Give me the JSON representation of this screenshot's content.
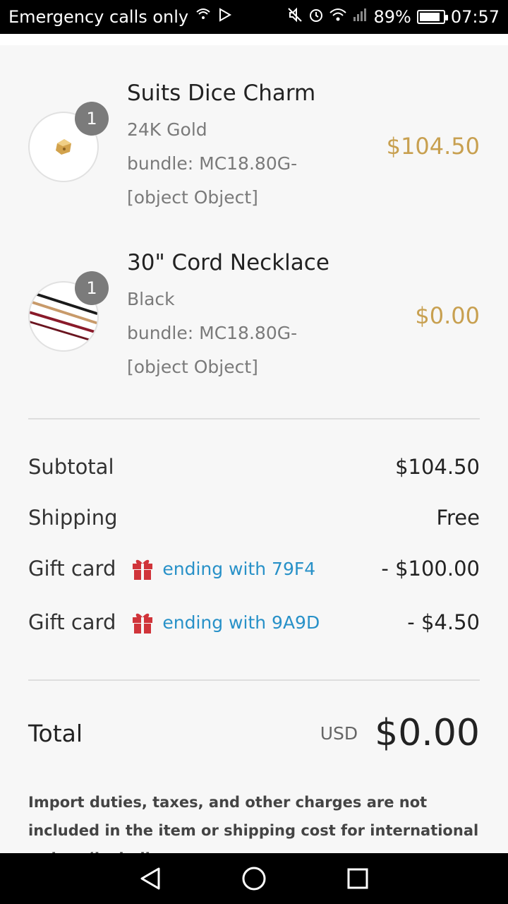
{
  "status_bar": {
    "carrier": "Emergency calls only",
    "battery": "89%",
    "battery_level": 0.89,
    "time": "07:57"
  },
  "items": [
    {
      "title": "Suits Dice Charm",
      "variant": "24K Gold",
      "bundle": "bundle: MC18.80G-[object Object]",
      "price": "$104.50",
      "quantity": "1",
      "thumb": "gold-dice-charm"
    },
    {
      "title": "30\" Cord Necklace",
      "variant": "Black",
      "bundle": "bundle: MC18.80G-[object Object]",
      "price": "$0.00",
      "quantity": "1",
      "thumb": "cord-necklace"
    }
  ],
  "summary": {
    "subtotal_label": "Subtotal",
    "subtotal_value": "$104.50",
    "shipping_label": "Shipping",
    "shipping_value": "Free",
    "gift_cards": [
      {
        "label": "Gift card",
        "ending": "ending with 79F4",
        "amount": "- $100.00"
      },
      {
        "label": "Gift card",
        "ending": "ending with 9A9D",
        "amount": "- $4.50"
      }
    ],
    "total_label": "Total",
    "currency": "USD",
    "total_value": "$0.00"
  },
  "notice": "Import duties, taxes, and other charges are not included in the item or shipping cost for international orders (including",
  "colors": {
    "price_gold": "#c8a050",
    "gift_red": "#d0343a",
    "link_blue": "#2891c8"
  }
}
